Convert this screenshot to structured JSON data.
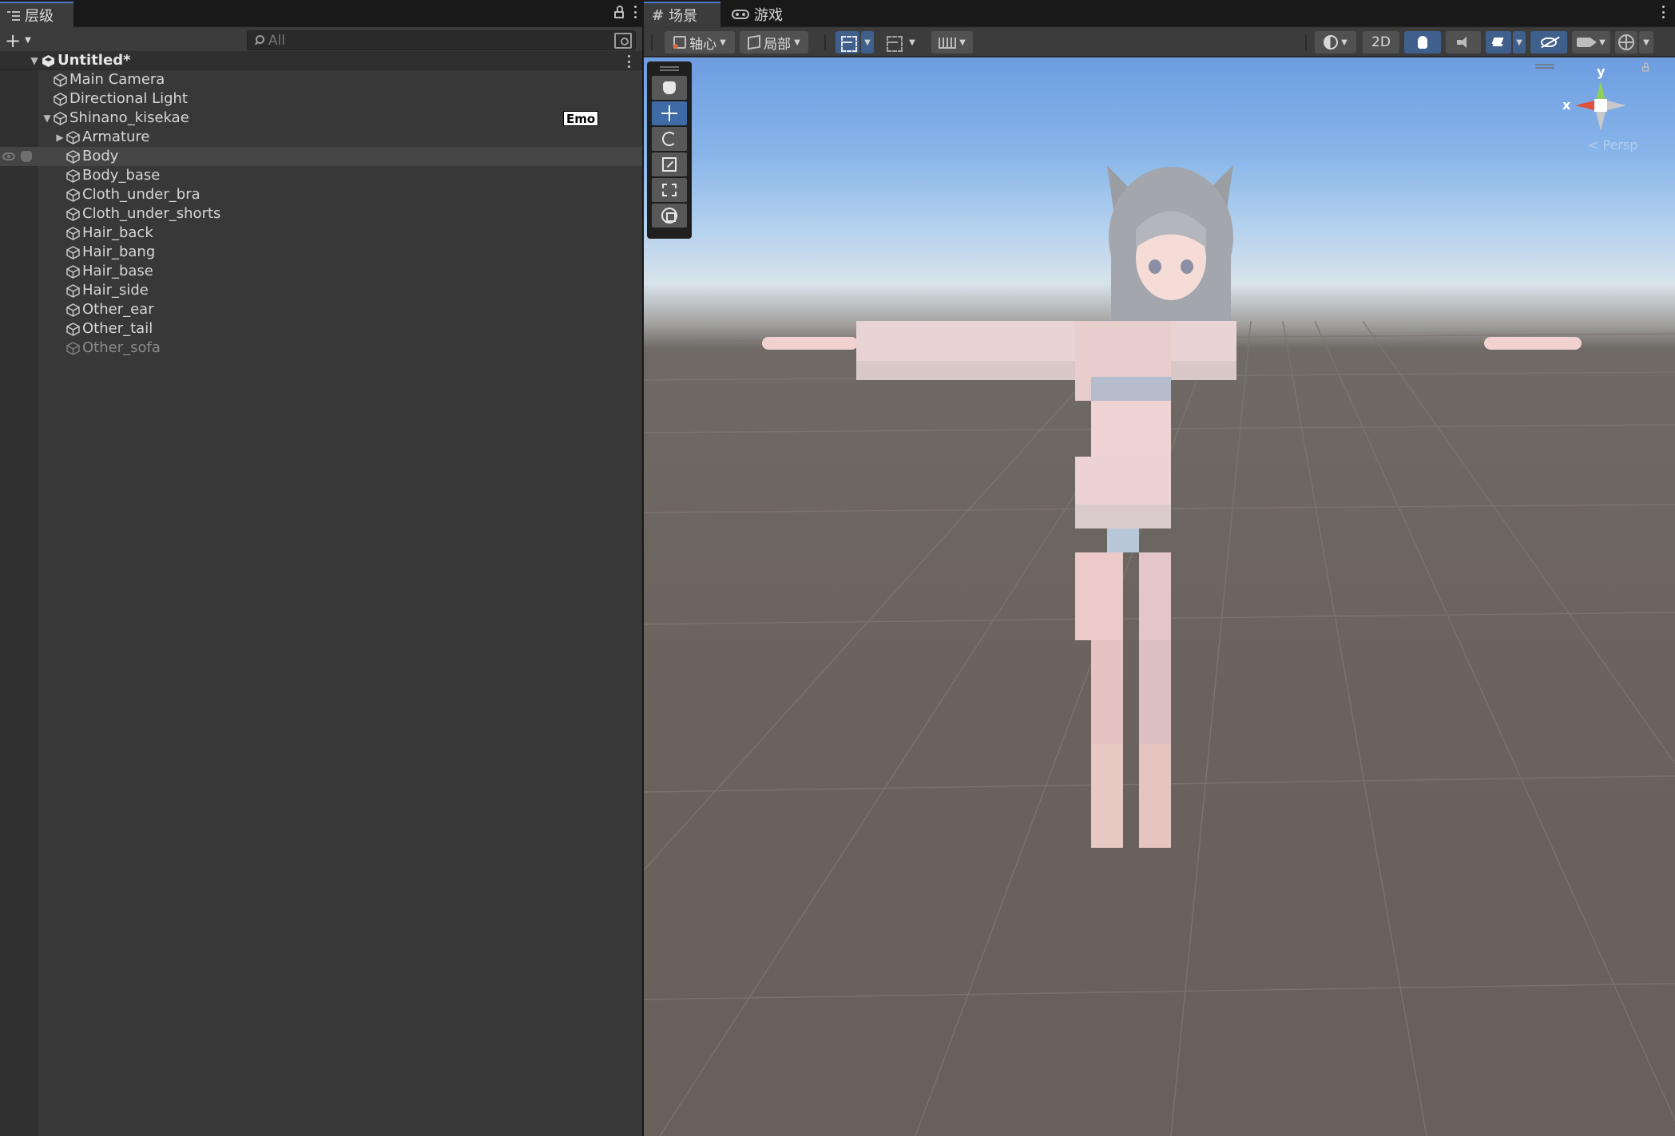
{
  "hierarchy": {
    "tab_label": "层级",
    "search_placeholder": "All",
    "scene_name": "Untitled*",
    "objects": [
      {
        "name": "Main Camera"
      },
      {
        "name": "Directional Light"
      },
      {
        "name": "Shinano_kisekae",
        "badge": "Emo"
      },
      {
        "name": "Armature"
      },
      {
        "name": "Body"
      },
      {
        "name": "Body_base"
      },
      {
        "name": "Cloth_under_bra"
      },
      {
        "name": "Cloth_under_shorts"
      },
      {
        "name": "Hair_back"
      },
      {
        "name": "Hair_bang"
      },
      {
        "name": "Hair_base"
      },
      {
        "name": "Hair_side"
      },
      {
        "name": "Other_ear"
      },
      {
        "name": "Other_tail"
      },
      {
        "name": "Other_sofa",
        "inactive": true
      }
    ]
  },
  "scene_view": {
    "tabs": [
      {
        "label": "场景",
        "icon": "grid-hash-icon",
        "active": true
      },
      {
        "label": "游戏",
        "icon": "gamepad-icon",
        "active": false
      }
    ],
    "toolbar": {
      "pivot_label": "轴心",
      "local_label": "局部",
      "mode_2d_label": "2D"
    },
    "tools": [
      "hand-tool",
      "move-tool",
      "rotate-tool",
      "scale-tool",
      "rect-tool",
      "transform-tool"
    ],
    "active_tool": "move-tool",
    "orientation": {
      "x_label": "x",
      "y_label": "y",
      "projection": "< Persp"
    }
  },
  "colors": {
    "accent": "#4d78cc",
    "active_tool": "#3e6aa6",
    "badge_bg": "#ffffff"
  }
}
